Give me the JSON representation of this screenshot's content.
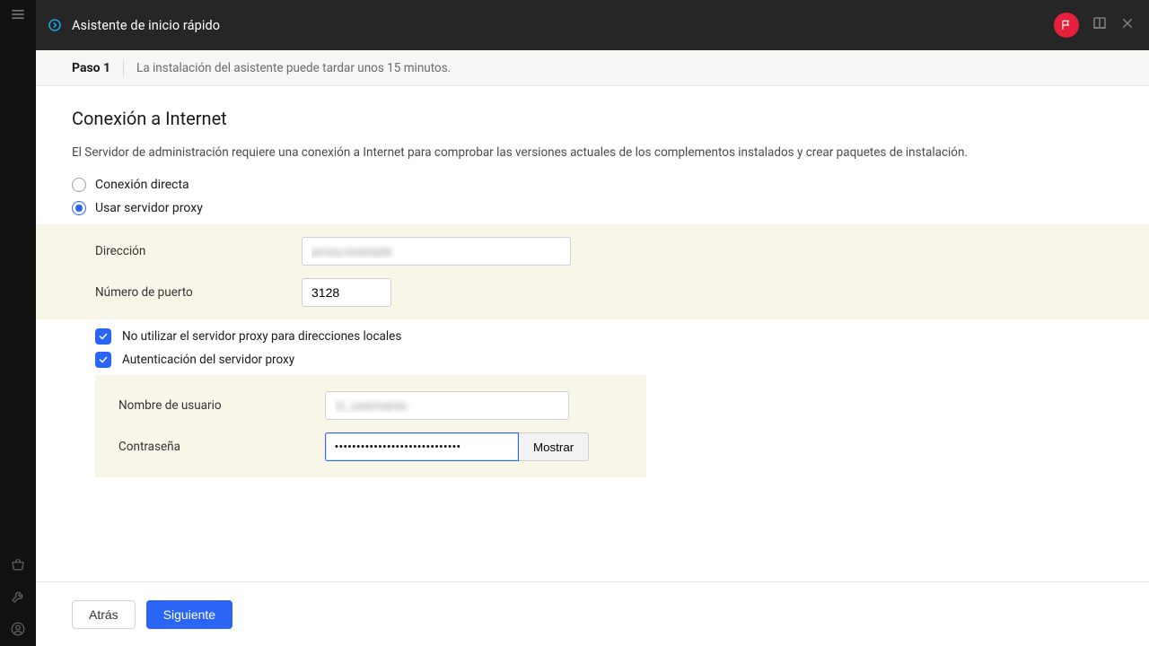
{
  "header": {
    "title": "Asistente de inicio rápido"
  },
  "stepbar": {
    "step_label": "Paso 1",
    "step_desc": "La instalación del asistente puede tardar unos 15 minutos."
  },
  "section": {
    "title": "Conexión a Internet",
    "desc": "El Servidor de administración requiere una conexión a Internet para comprobar las versiones actuales de los complementos instalados y crear paquetes de instalación."
  },
  "radio": {
    "direct_label": "Conexión directa",
    "proxy_label": "Usar servidor proxy"
  },
  "form": {
    "address_label": "Dirección",
    "address_value": "proxy.example",
    "port_label": "Número de puerto",
    "port_value": "3128",
    "bypass_local_label": "No utilizar el servidor proxy para direcciones locales",
    "auth_label": "Autenticación del servidor proxy",
    "username_label": "Nombre de usuario",
    "username_value": "cl_username",
    "password_label": "Contraseña",
    "password_value": "•••••••••••••••••••••••••••••",
    "show_button": "Mostrar"
  },
  "footer": {
    "back": "Atrás",
    "next": "Siguiente"
  }
}
